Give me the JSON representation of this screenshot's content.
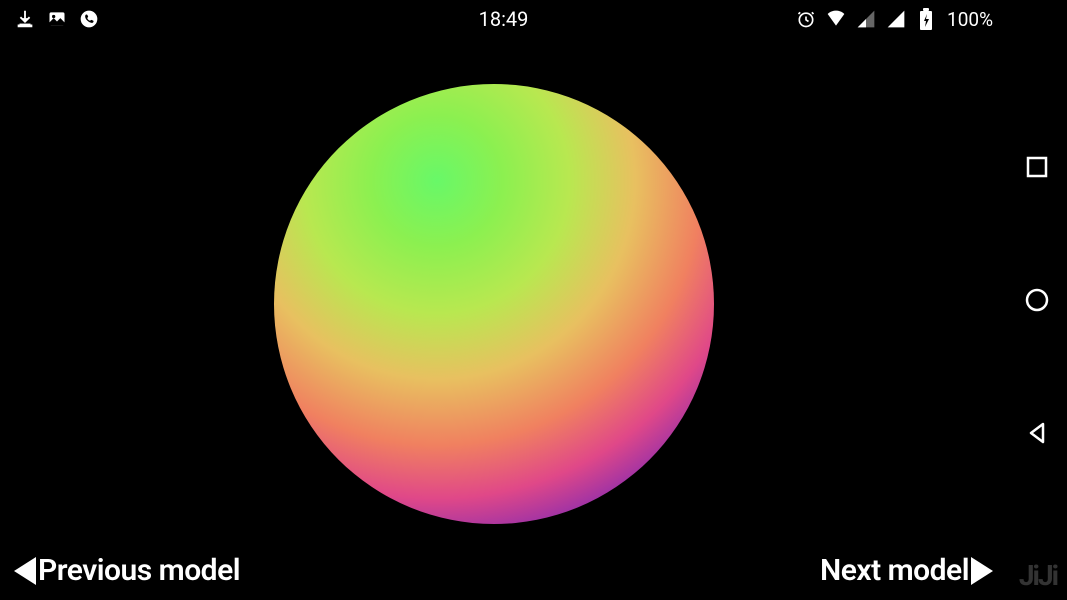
{
  "status_bar": {
    "time": "18:49",
    "battery": "100%"
  },
  "navigation": {
    "previous_label": "Previous model",
    "next_label": "Next model"
  },
  "watermark": "JiJi"
}
